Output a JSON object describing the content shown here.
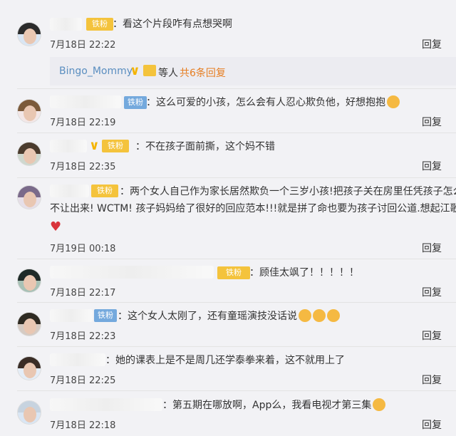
{
  "comments": [
    {
      "text": "：看这个片段咋有点想哭啊",
      "time": "7月18日 22:22",
      "reply": "回复",
      "badge": "铁粉"
    },
    {
      "text": "：这么可爱的小孩，怎么会有人忍心欺负他，好想抱抱",
      "time": "7月18日 22:19",
      "reply": "回复",
      "badge": "铁粉"
    },
    {
      "text": "：不在孩子面前撕，这个妈不错",
      "time": "7月18日 22:35",
      "reply": "回复",
      "badge": "铁粉"
    },
    {
      "text": "：两个女人自己作为家长居然欺负一个三岁小孩!把孩子关在房里任凭孩子怎么",
      "text2": "不让出来! WCTM! 孩子妈妈给了很好的回应范本!!!就是拼了命也要为孩子讨回公道.想起江歌",
      "time": "7月19日 00:18",
      "reply": "回复",
      "badge": "铁粉"
    },
    {
      "text": "：顾佳太飒了！！！！！",
      "time": "7月18日 22:17",
      "reply": "回复",
      "badge": "铁粉"
    },
    {
      "text": "：这个女人太刚了，还有童瑶演技没话说",
      "time": "7月18日 22:23",
      "reply": "回复",
      "badge": "铁粉"
    },
    {
      "text": "：她的课表上是不是周几还学泰拳来着，这不就用上了",
      "time": "7月18日 22:25",
      "reply": "回复"
    },
    {
      "text": "：第五期在哪放啊，App么，我看电视才第三集",
      "time": "7月18日 22:18",
      "reply": "回复"
    }
  ],
  "summary": {
    "user": "Bingo_Mommy",
    "others": "等人",
    "count": "共6条回复"
  },
  "colors": {
    "accent": "#5a8ec0",
    "fan_badge": "#f4c33c",
    "fan_badge_blue": "#74a9dd",
    "count": "#e67e22"
  }
}
